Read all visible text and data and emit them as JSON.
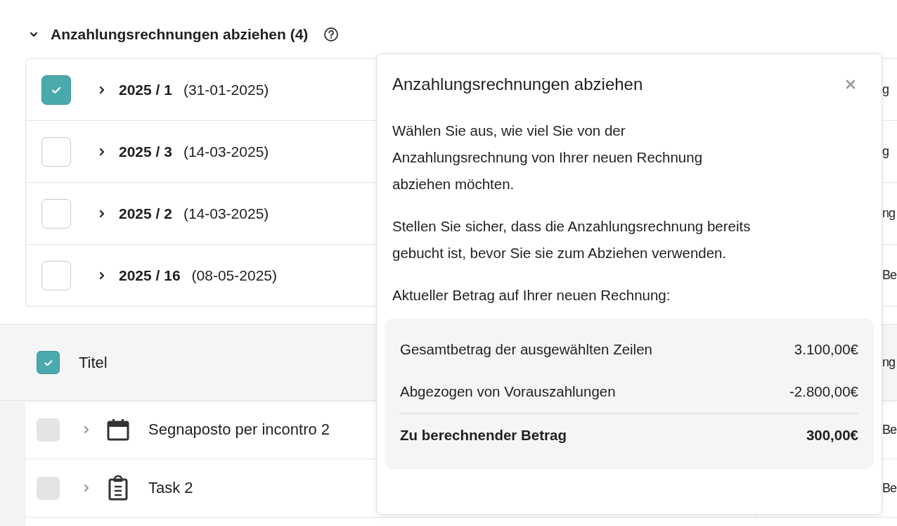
{
  "section": {
    "title": "Anzahlungsrechnungen abziehen (4)",
    "expanded": true
  },
  "invoices": [
    {
      "number": "2025 / 1",
      "date": "(31-01-2025)",
      "checked": true,
      "column_2": "g"
    },
    {
      "number": "2025 / 3",
      "date": "(14-03-2025)",
      "checked": false,
      "column_2": "g"
    },
    {
      "number": "2025 / 2",
      "date": "(14-03-2025)",
      "checked": false,
      "column_2": "ng"
    },
    {
      "number": "2025 / 16",
      "date": "(08-05-2025)",
      "checked": false,
      "column_2": "Be"
    }
  ],
  "table": {
    "header": {
      "checked": true,
      "title": "Titel",
      "column_2": "ng"
    },
    "rows": [
      {
        "kind": "event",
        "title": "Segnaposto per incontro 2",
        "disabled": true,
        "column_2": "Be"
      },
      {
        "kind": "task",
        "title": "Task 2",
        "disabled": true,
        "column_2": "Be"
      }
    ]
  },
  "popover": {
    "title": "Anzahlungsrechnungen abziehen",
    "paragraphs": [
      "Wählen Sie aus, wie viel Sie von der\nAnzahlungsrechnung von Ihrer neuen Rechnung\nabziehen möchten.",
      "Stellen Sie sicher, dass die Anzahlungsrechnung bereits\ngebucht ist, bevor Sie sie zum Abziehen verwenden.",
      "Aktueller Betrag auf Ihrer neuen Rechnung:"
    ],
    "summary": {
      "lines": [
        {
          "label": "Gesamtbetrag der ausgewählten Zeilen",
          "value": "3.100,00€"
        },
        {
          "label": "Abgezogen von Vorauszahlungen",
          "value": "-2.800,00€"
        }
      ],
      "total": {
        "label": "Zu berechnender Betrag",
        "value": "300,00€"
      }
    }
  }
}
